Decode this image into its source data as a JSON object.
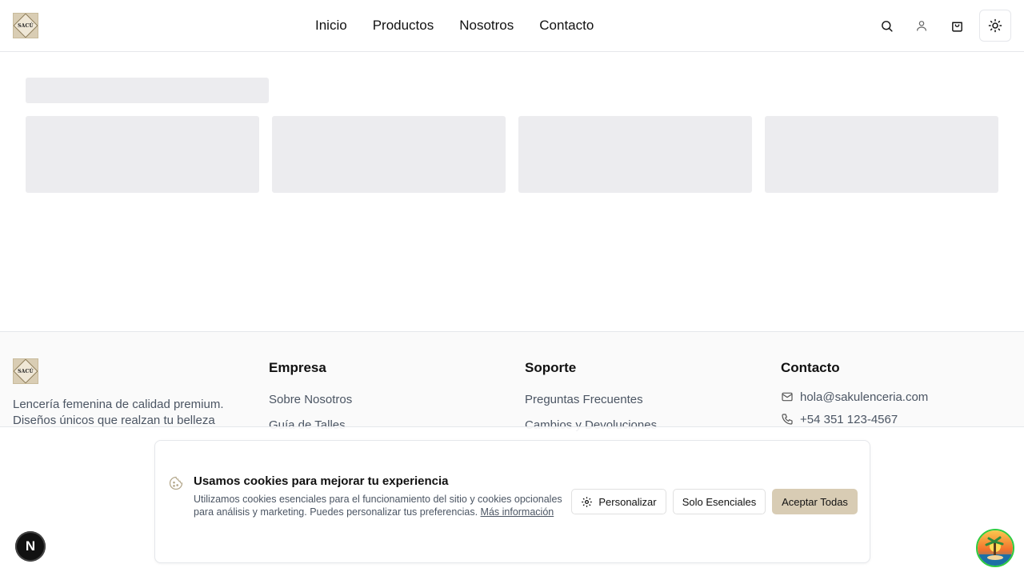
{
  "brand": {
    "logo_text": "SACÚ"
  },
  "nav": {
    "items": [
      "Inicio",
      "Productos",
      "Nosotros",
      "Contacto"
    ]
  },
  "header_icons": [
    "search-icon",
    "user-icon",
    "shopping-bag-icon",
    "sun-icon"
  ],
  "footer": {
    "description": "Lencería femenina de calidad premium. Diseños únicos que realzan tu belleza",
    "empresa": {
      "title": "Empresa",
      "links": [
        "Sobre Nosotros",
        "Guía de Talles"
      ]
    },
    "soporte": {
      "title": "Soporte",
      "links": [
        "Preguntas Frecuentes",
        "Cambios y Devoluciones"
      ]
    },
    "contacto": {
      "title": "Contacto",
      "email": "hola@sakulenceria.com",
      "phone": "+54 351 123-4567"
    }
  },
  "cookie": {
    "title": "Usamos cookies para mejorar tu experiencia",
    "body": "Utilizamos cookies esenciales para el funcionamiento del sitio y cookies opcionales para análisis y marketing. Puedes personalizar tus preferencias.",
    "more_link": "Más información",
    "personalize": "Personalizar",
    "essentials": "Solo Esenciales",
    "accept": "Aceptar Todas"
  },
  "next_badge": "N",
  "colors": {
    "accent": "#d8ccb4",
    "skeleton": "#ececef",
    "border": "#e5e7eb"
  }
}
